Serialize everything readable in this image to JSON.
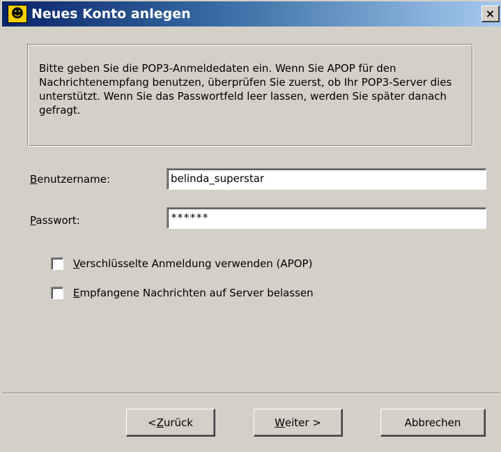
{
  "window": {
    "title": "Neues Konto anlegen",
    "close_glyph": "×",
    "icon": "app-logo-icon"
  },
  "info": {
    "text": "Bitte geben Sie die POP3-Anmeldedaten ein. Wenn Sie APOP für den Nachrichtenempfang benutzen, überprüfen Sie zuerst, ob Ihr POP3-Server dies unterstützt. Wenn Sie das Passwortfeld leer lassen, werden Sie später danach gefragt."
  },
  "form": {
    "username": {
      "label_first": "B",
      "label_rest": "enutzername:",
      "value": "belinda_superstar"
    },
    "password": {
      "label_first": "P",
      "label_rest": "asswort:",
      "value": "******"
    }
  },
  "options": [
    {
      "label_first": "V",
      "label_rest": "erschlüsselte Anmeldung verwenden (APOP)",
      "checked": false
    },
    {
      "label_first": "E",
      "label_rest": "mpfangene Nachrichten auf Server belassen",
      "checked": false
    }
  ],
  "buttons": {
    "back_prefix": "< ",
    "back_first": "Z",
    "back_rest": "urück",
    "next_first": "W",
    "next_rest": "eiter >",
    "cancel": "Abbrechen"
  },
  "colors": {
    "titlebar_start": "#0a246a",
    "titlebar_end": "#a6caf0",
    "face": "#d4d0c8"
  }
}
